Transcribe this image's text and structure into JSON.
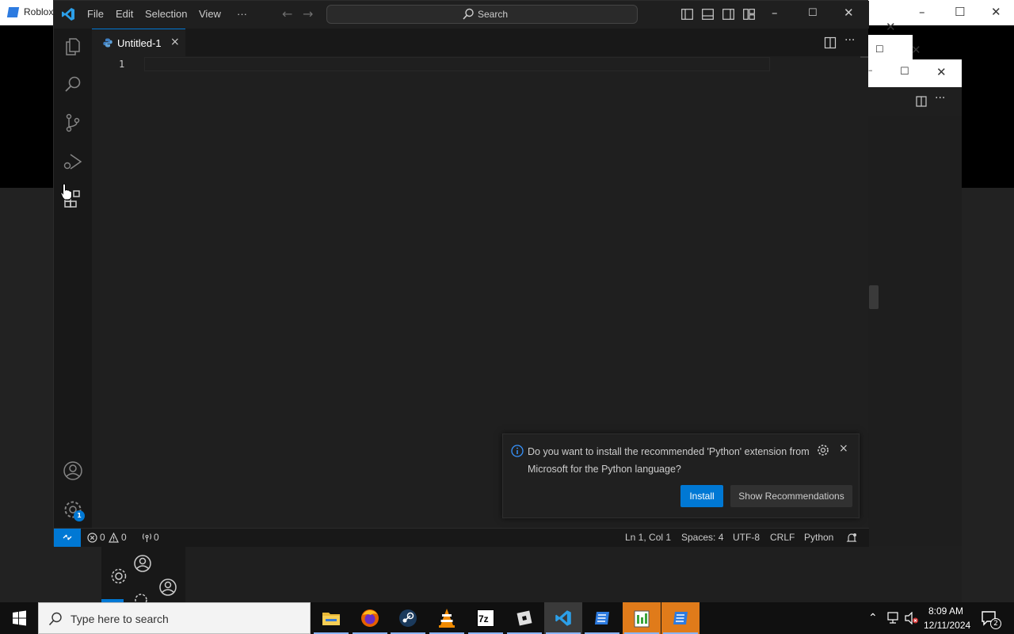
{
  "background": {
    "roblox_title": "Roblox"
  },
  "vscode": {
    "menu": [
      "File",
      "Edit",
      "Selection",
      "View",
      "···"
    ],
    "search_label": "Search",
    "tab": {
      "label": "Untitled-1",
      "close": "×"
    },
    "editor": {
      "line_number": "1"
    },
    "activity_badge": "1",
    "notification": {
      "message": "Do you want to install the recommended 'Python' extension from Microsoft for the Python language?",
      "install_label": "Install",
      "recommendations_label": "Show Recommendations",
      "close": "×"
    },
    "statusbar": {
      "errors": "0",
      "warnings": "0",
      "ports": "0",
      "position": "Ln 1, Col 1",
      "spaces": "Spaces: 4",
      "encoding": "UTF-8",
      "eol": "CRLF",
      "language": "Python"
    },
    "colors": {
      "accent": "#0078d4",
      "background": "#1f1f1f",
      "activitybar": "#181818"
    }
  },
  "taskbar": {
    "search_placeholder": "Type here to search",
    "apps": [
      "file-explorer",
      "firefox",
      "steam",
      "vlc",
      "7zip",
      "roblox-studio",
      "vscode",
      "roblox",
      "notepad-plus",
      "roblox-player"
    ],
    "time": "8:09 AM",
    "date": "12/11/2024",
    "notification_count": "2"
  }
}
